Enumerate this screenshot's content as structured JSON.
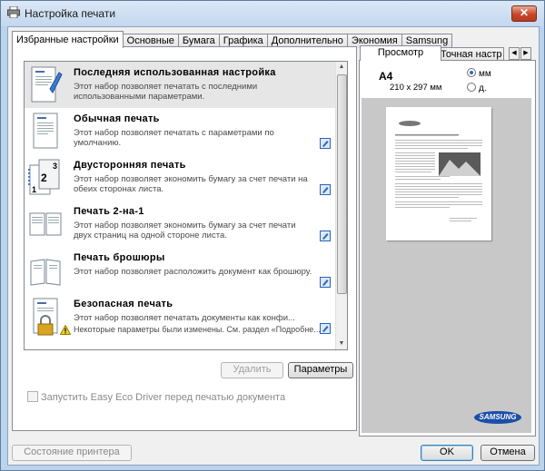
{
  "window": {
    "title": "Настройка печати",
    "close": "✕"
  },
  "tabs": [
    "Избранные настройки",
    "Основные",
    "Бумага",
    "Графика",
    "Дополнительно",
    "Экономия",
    "Samsung"
  ],
  "favorites": {
    "items": [
      {
        "title": "Последняя использованная настройка",
        "desc": "Этот набор позволяет печатать с последними использованными параметрами.",
        "icon": "last-used-icon"
      },
      {
        "title": "Обычная печать",
        "desc": "Этот набор позволяет печатать с параметрами по умолчанию.",
        "icon": "normal-print-icon"
      },
      {
        "title": "Двусторонняя печать",
        "desc": "Этот набор позволяет экономить бумагу за счет печати на обеих сторонах листа.",
        "icon": "duplex-print-icon"
      },
      {
        "title": "Печать 2-на-1",
        "desc": "Этот набор позволяет экономить бумагу за счет печати двух страниц на одной стороне листа.",
        "icon": "two-up-icon"
      },
      {
        "title": "Печать брошюры",
        "desc": "Этот набор позволяет расположить документ как брошюру.",
        "icon": "booklet-icon"
      },
      {
        "title": "Безопасная печать",
        "desc": "Этот набор позволяет печатать документы как конфи...",
        "warning": "Некоторые параметры были изменены. См. раздел «Подробне...",
        "icon": "secure-print-icon"
      }
    ],
    "delete_label": "Удалить",
    "params_label": "Параметры"
  },
  "eco_checkbox": {
    "label": "Запустить Easy Eco Driver перед печатью документа",
    "checked": false
  },
  "preview": {
    "tabs": [
      "Просмотр",
      "Точная настр"
    ],
    "paper": "A4",
    "dims": "210 x 297 мм",
    "units": [
      {
        "label": "мм",
        "selected": true
      },
      {
        "label": "д.",
        "selected": false
      }
    ],
    "brand": "SAMSUNG"
  },
  "footer": {
    "status_label": "Состояние принтера",
    "ok_label": "OK",
    "cancel_label": "Отмена"
  },
  "colors": {
    "titlebar": "#c3d7ee",
    "brand": "#1a4ea8",
    "accent": "#2a6cc7"
  }
}
